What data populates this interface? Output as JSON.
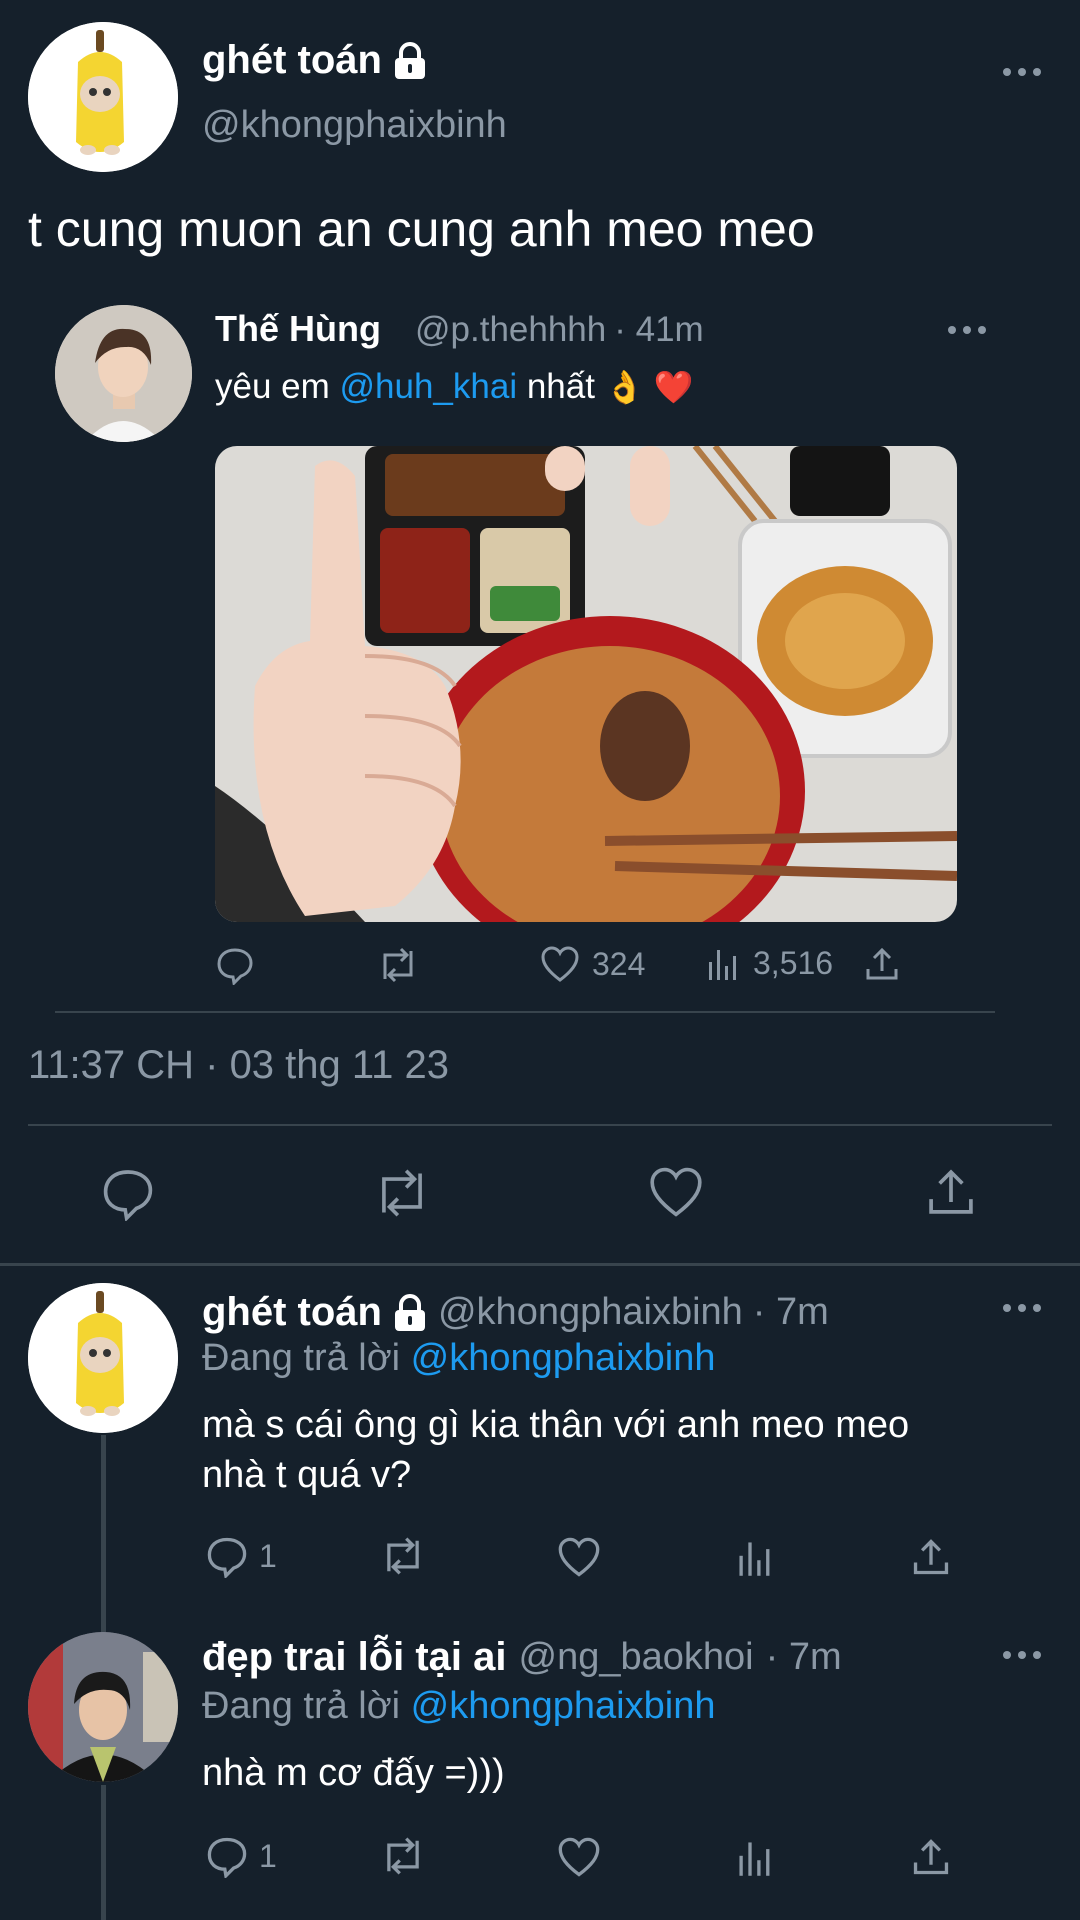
{
  "main_tweet": {
    "name": "ghét toán",
    "handle": "@khongphaixbinh",
    "text": "t cung muon an cung anh meo meo",
    "timestamp": "11:37 CH · 03 thg 11 23",
    "lock_icon": "lock-icon",
    "more_icon": "more-icon"
  },
  "quote": {
    "name": "Thế Hùng",
    "handle": "@p.thehhhh",
    "time": "· 41m",
    "text_before": "yêu em ",
    "mention": "@huh_khai",
    "text_after": " nhất",
    "emoji": "👌 ❤️",
    "likes": "324",
    "views": "3,516"
  },
  "replies": [
    {
      "name": "ghét toán",
      "handle": "@khongphaixbinh",
      "time": "· 7m",
      "replying_label": "Đang trả lời",
      "replying_to": "@khongphaixbinh",
      "text_line1": "mà s cái ông gì kia thân với anh meo meo",
      "text_line2": "nhà t quá v?",
      "reply_count": "1"
    },
    {
      "name": "đẹp trai lỗi tại ai",
      "handle": "@ng_baokhoi",
      "time": "· 7m",
      "replying_label": "Đang trả lời",
      "replying_to": "@khongphaixbinh",
      "text_line1": "nhà m cơ đấy =)))",
      "reply_count": "1"
    }
  ],
  "colors": {
    "background": "#15202b",
    "muted": "#8b98a5",
    "link": "#1d9bf0",
    "divider": "#38444d"
  }
}
